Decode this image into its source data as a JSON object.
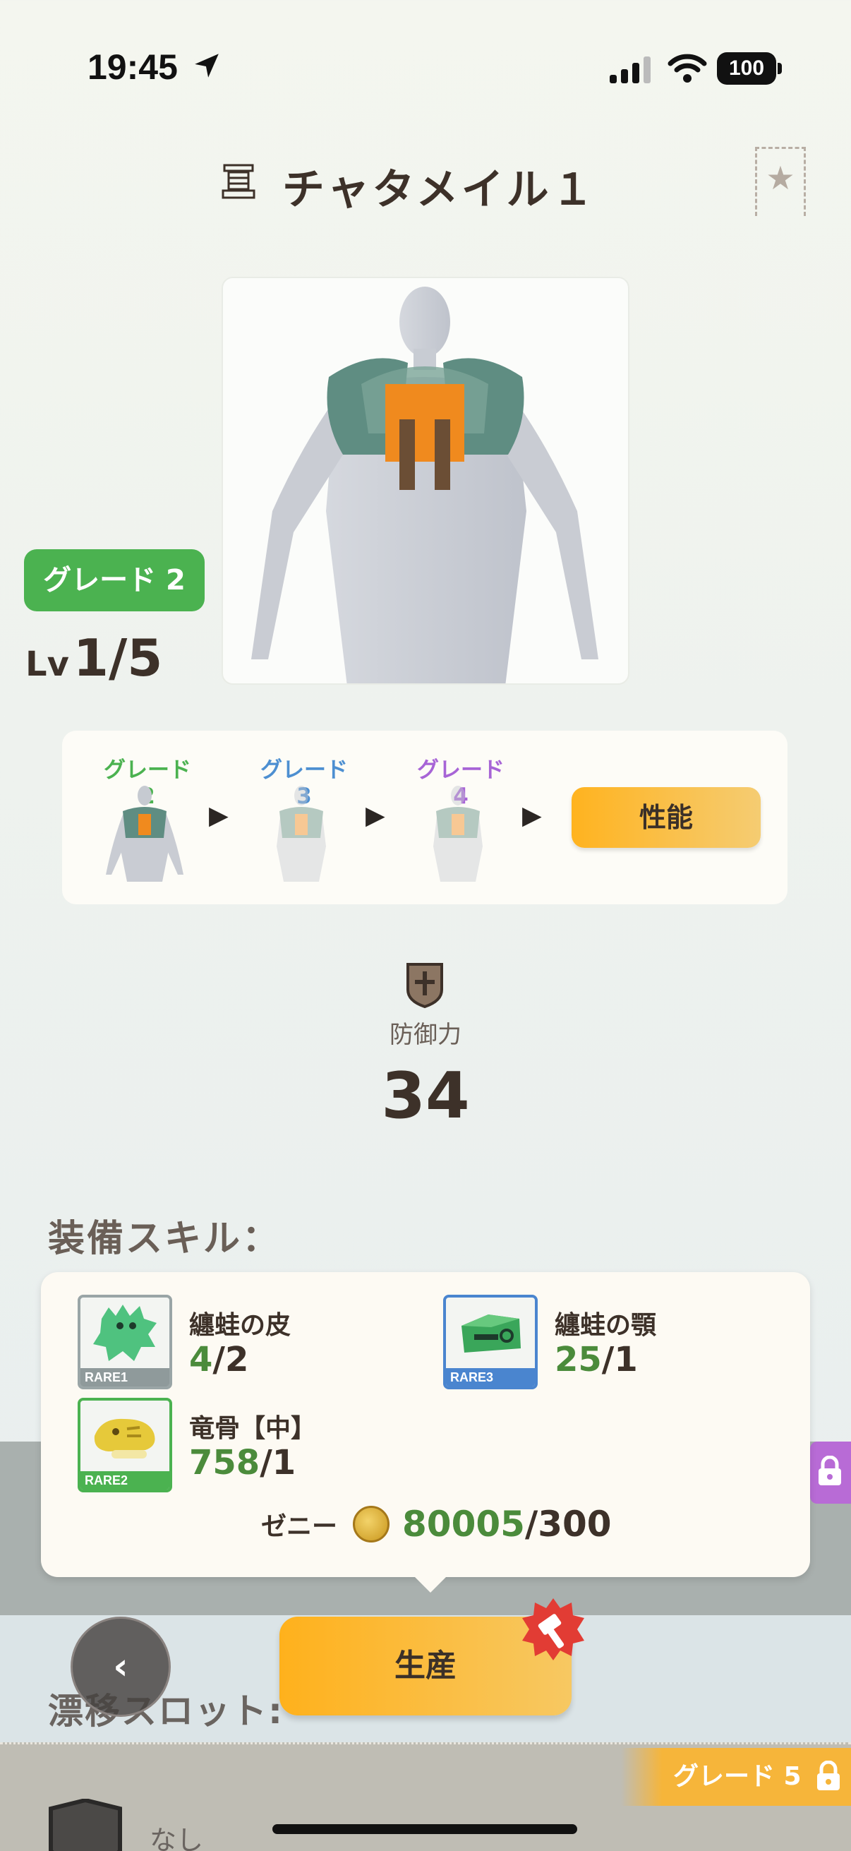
{
  "status": {
    "time": "19:45",
    "battery": "100"
  },
  "header": {
    "title": "チャタメイル１"
  },
  "item": {
    "grade_label": "グレード 2",
    "lv_prefix": "Lv",
    "lv_value": "1/5"
  },
  "grades": [
    {
      "label": "グレード 2",
      "color": "#4bb250"
    },
    {
      "label": "グレード 3",
      "color": "#4d8fd1"
    },
    {
      "label": "グレード 4",
      "color": "#a764d6"
    }
  ],
  "performance_button": "性能",
  "defense": {
    "label": "防御力",
    "value": "34"
  },
  "skills_title": "装備スキル：",
  "materials": [
    {
      "name": "纏蛙の皮",
      "have": "4",
      "need": "/2",
      "rarity": "RARE1",
      "rarity_color": "#8f9a9b"
    },
    {
      "name": "纏蛙の顎",
      "have": "25",
      "need": "/1",
      "rarity": "RARE3",
      "rarity_color": "#4a85cf"
    },
    {
      "name": "竜骨【中】",
      "have": "758",
      "need": "/1",
      "rarity": "RARE2",
      "rarity_color": "#4bb250"
    }
  ],
  "zeny": {
    "label": "ゼニー",
    "have": "80005",
    "need": "/300"
  },
  "craft_button": "生産",
  "slot_label": "漂移スロット:",
  "grade5_tag": "グレード 5",
  "slot_none": "なし"
}
